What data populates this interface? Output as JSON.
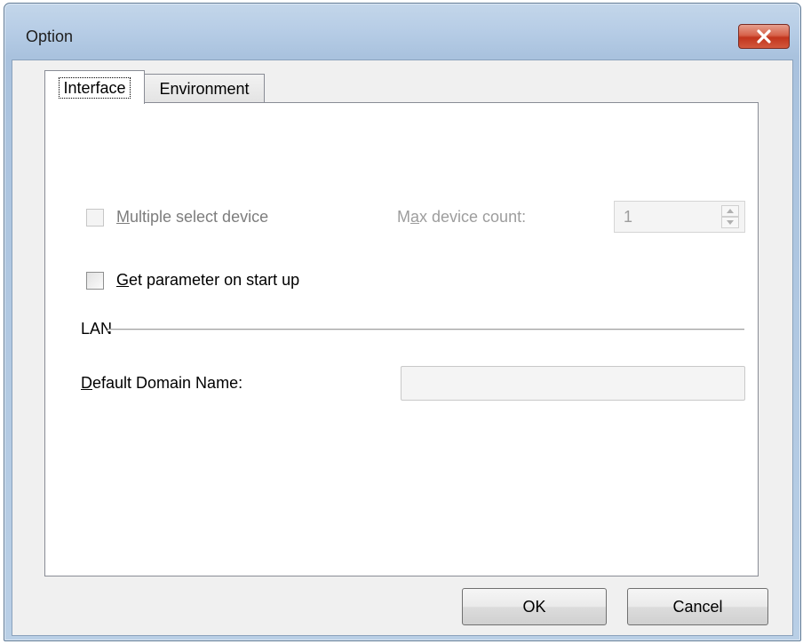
{
  "window": {
    "title": "Option",
    "close_icon": "close-x-icon",
    "close_color": "#c7432b"
  },
  "tabs": [
    {
      "label": "Interface",
      "active": true
    },
    {
      "label": "Environment",
      "active": false
    }
  ],
  "interface": {
    "multiple_select": {
      "label_prefix": "",
      "label_mnemonic": "M",
      "label_rest": "ultiple select device",
      "checked": false,
      "enabled": false
    },
    "max_device_count": {
      "label_prefix": "M",
      "label_mnemonic": "a",
      "label_rest": "x device count:",
      "value": "1",
      "enabled": false
    },
    "get_parameter": {
      "label_mnemonic": "G",
      "label_rest": "et parameter on start up",
      "checked": false,
      "enabled": true
    },
    "lan_group": {
      "label": "LAN"
    },
    "default_domain": {
      "label_mnemonic": "D",
      "label_rest": "efault Domain Name:",
      "value": "",
      "enabled": false
    }
  },
  "buttons": {
    "ok": "OK",
    "cancel": "Cancel"
  }
}
